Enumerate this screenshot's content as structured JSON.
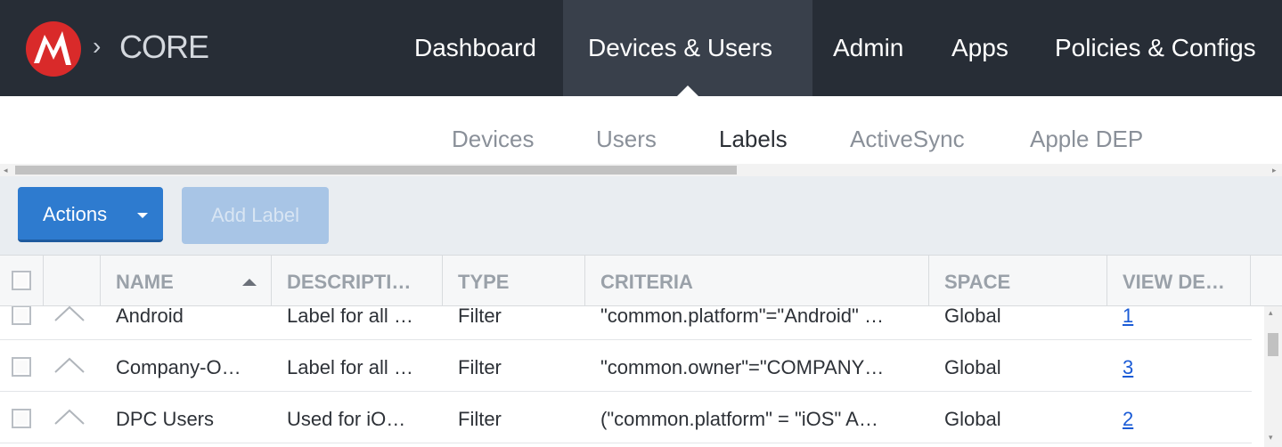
{
  "brand": {
    "separator": "›",
    "name": "CORE"
  },
  "topnav": {
    "items": [
      {
        "label": "Dashboard",
        "active": false
      },
      {
        "label": "Devices & Users",
        "active": true
      },
      {
        "label": "Admin",
        "active": false
      },
      {
        "label": "Apps",
        "active": false
      },
      {
        "label": "Policies & Configs",
        "active": false
      }
    ]
  },
  "subnav": {
    "items": [
      {
        "label": "Devices",
        "active": false
      },
      {
        "label": "Users",
        "active": false
      },
      {
        "label": "Labels",
        "active": true
      },
      {
        "label": "ActiveSync",
        "active": false
      },
      {
        "label": "Apple DEP",
        "active": false
      }
    ]
  },
  "toolbar": {
    "actions_label": "Actions",
    "add_label": "Add Label"
  },
  "table": {
    "columns": [
      "NAME",
      "DESCRIPTI…",
      "TYPE",
      "CRITERIA",
      "SPACE",
      "VIEW DE…"
    ],
    "rows": [
      {
        "name": "Android",
        "description": "Label for all …",
        "type": "Filter",
        "criteria": "\"common.platform\"=\"Android\" …",
        "space": "Global",
        "view": "1"
      },
      {
        "name": "Company-O…",
        "description": "Label for all …",
        "type": "Filter",
        "criteria": "\"common.owner\"=\"COMPANY…",
        "space": "Global",
        "view": "3"
      },
      {
        "name": "DPC Users",
        "description": "Used for iO…",
        "type": "Filter",
        "criteria": "(\"common.platform\" = \"iOS\" A…",
        "space": "Global",
        "view": "2"
      }
    ]
  },
  "colors": {
    "topnav_bg": "#272d36",
    "topnav_active": "#39404b",
    "primary_button": "#2e7bcf",
    "disabled_button": "#a8c5e6",
    "link": "#1a5bd6"
  },
  "icons": {
    "logo": "mobileiron-logo",
    "sort": "sort-ascending-icon",
    "expand": "chevron-up-icon",
    "dropdown": "caret-down-icon"
  }
}
